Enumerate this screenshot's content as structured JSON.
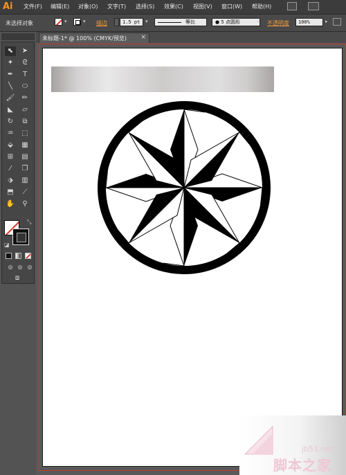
{
  "app": {
    "logo": "Ai",
    "accent": "#f7931e"
  },
  "menu": {
    "items": [
      "文件(F)",
      "编辑(E)",
      "对象(O)",
      "文字(T)",
      "选择(S)",
      "效果(C)",
      "视图(V)",
      "窗口(W)",
      "帮助(H)"
    ]
  },
  "control": {
    "selection_status": "未选择对象",
    "stroke_label": "描边",
    "stroke_weight": "1.5 pt",
    "profile_label": "等比",
    "brush_label": "5 点圆形",
    "opacity_label": "不透明度",
    "opacity_value": "100%"
  },
  "document": {
    "tab_label": "未标题-1* @ 100% (CMYK/预览)",
    "close_glyph": "×"
  },
  "colors": {
    "fill": "#ffffff",
    "stroke": "#000000",
    "none_slash": "#d9332b",
    "bleed": "#c0392b"
  },
  "watermark": {
    "url": "jb51.net",
    "name": "脚本之家"
  }
}
